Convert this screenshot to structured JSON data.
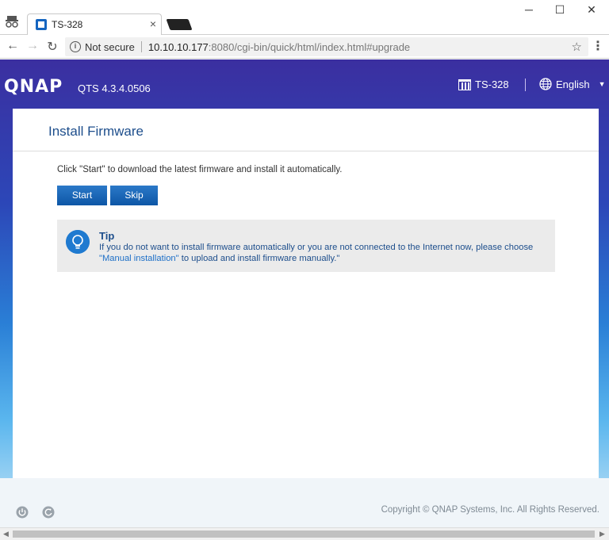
{
  "browser": {
    "tab_title": "TS-328",
    "tab_close": "×",
    "not_secure": "Not secure",
    "url_host": "10.10.10.177",
    "url_rest": ":8080/cgi-bin/quick/html/index.html#upgrade",
    "controls": {
      "minimize": "─",
      "maximize": "☐",
      "close": "✕"
    }
  },
  "header": {
    "logo": "QNAP",
    "version": "QTS 4.3.4.0506",
    "device_name": "TS-328",
    "language": "English"
  },
  "main": {
    "title": "Install Firmware",
    "instruction": "Click \"Start\" to download the latest firmware and install it automatically.",
    "start_label": "Start",
    "skip_label": "Skip",
    "tip": {
      "title": "Tip",
      "text_before": "If you do not want to install firmware automatically or you are not connected to the Internet now, please choose ",
      "link": "\"Manual installation\"",
      "text_after": " to upload and install firmware manually.\""
    }
  },
  "footer": {
    "copyright": "Copyright © QNAP Systems, Inc. All Rights Reserved."
  },
  "colors": {
    "header_gradient_top": "#3b2fa0",
    "accent_blue": "#0d56a6",
    "title_blue": "#1d4e8c"
  }
}
